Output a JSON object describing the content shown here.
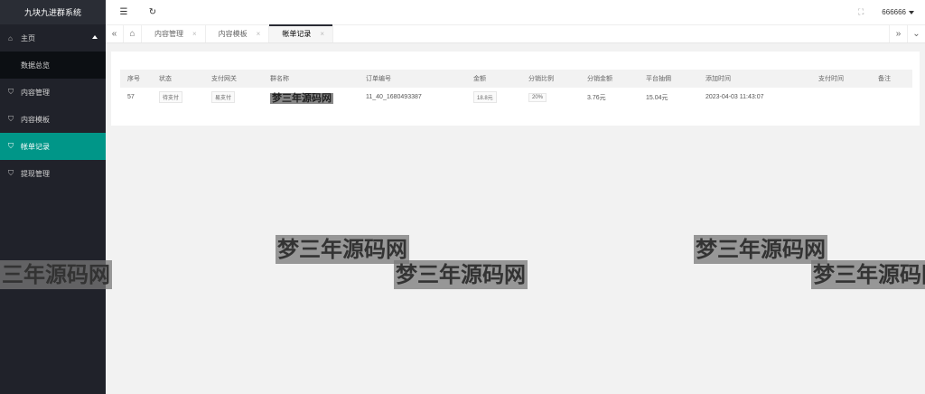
{
  "app": {
    "title": "九块九进群系统"
  },
  "sidebar": {
    "home": {
      "label": "主页",
      "icon": "home-icon"
    },
    "sub": [
      {
        "label": "数据总览"
      }
    ],
    "items": [
      {
        "label": "内容管理",
        "icon": "check-shield-icon"
      },
      {
        "label": "内容模板",
        "icon": "check-shield-icon"
      },
      {
        "label": "帐单记录",
        "icon": "check-shield-icon",
        "active": true
      },
      {
        "label": "提现管理",
        "icon": "check-shield-icon"
      }
    ]
  },
  "header": {
    "user": "666666"
  },
  "tabs": [
    {
      "label": "内容管理",
      "close": "×"
    },
    {
      "label": "内容模板",
      "close": "×"
    },
    {
      "label": "帐单记录",
      "close": "×",
      "active": true
    }
  ],
  "table": {
    "headers": [
      "序号",
      "状态",
      "支付网关",
      "群名称",
      "订单编号",
      "金额",
      "分销比例",
      "分销金额",
      "平台抽佣",
      "添加时间",
      "支付时间",
      "备注"
    ],
    "rows": [
      {
        "id": "57",
        "status": "待支付",
        "gateway": "易支付",
        "group": "梦三年源码网",
        "order_no": "11_40_1680493387",
        "amount": "18.8元",
        "ratio": "20%",
        "dist_amount": "3.76元",
        "platform_fee": "15.04元",
        "added": "2023-04-03 11:43:07",
        "paid": "",
        "note": ""
      }
    ]
  },
  "watermarks": [
    "三年源码网",
    "梦三年源码网",
    "梦三年源码网",
    "梦三年源码网",
    "梦三年源码网"
  ]
}
